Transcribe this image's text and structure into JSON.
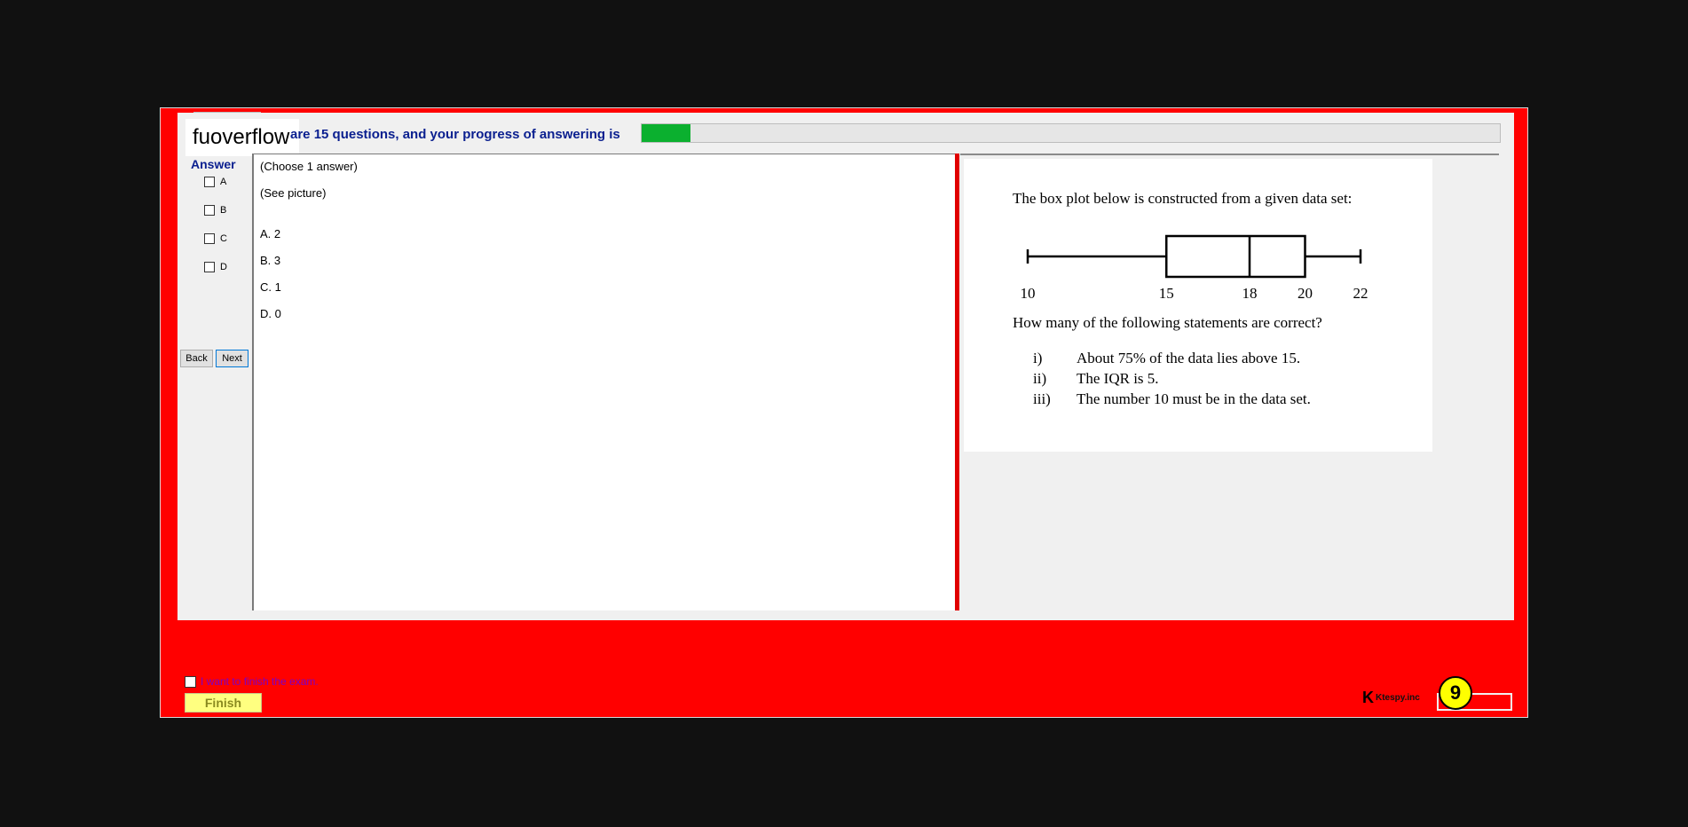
{
  "header": {
    "brand": "fuoverflow",
    "progress_text": "are 15 questions, and your progress of answering is",
    "progress_fraction": 0.057
  },
  "answer_panel": {
    "title": "Answer",
    "options": [
      "A",
      "B",
      "C",
      "D"
    ],
    "back_label": "Back",
    "next_label": "Next"
  },
  "question": {
    "instruction": "(Choose 1 answer)",
    "see_picture": "(See picture)",
    "choices": [
      "A.  2",
      "B.  3",
      "C.  1",
      "D.  0"
    ]
  },
  "picture": {
    "intro": "The box plot below is constructed from a given data set:",
    "tick_labels": [
      "10",
      "15",
      "18",
      "20",
      "22"
    ],
    "prompt": "How many of the following statements are correct?",
    "statements": [
      {
        "num": "i)",
        "text": "About 75% of the data lies above 15."
      },
      {
        "num": "ii)",
        "text": "The IQR is 5."
      },
      {
        "num": "iii)",
        "text": "The number 10 must be in the data set."
      }
    ]
  },
  "footer": {
    "finish_checkbox_label": "I want to finish the exam.",
    "finish_button": "Finish",
    "logo_text": "Ktespy.inc",
    "counter": "9"
  },
  "colors": {
    "frame": "#ff0000",
    "progress": "#0bb02f",
    "header_text": "#0a1f8f",
    "finish_button": "#ffff80",
    "badge": "#ffff00"
  },
  "chart_data": {
    "type": "box",
    "min": 10,
    "q1": 15,
    "median": 18,
    "q3": 20,
    "max": 22,
    "tick_labels": [
      "10",
      "15",
      "18",
      "20",
      "22"
    ]
  }
}
